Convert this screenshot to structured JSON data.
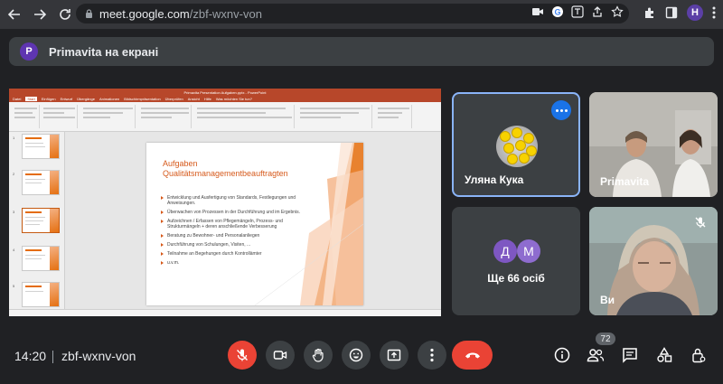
{
  "browser": {
    "url_host": "meet.google.com",
    "url_path": "/zbf-wxnv-von",
    "profile_initial": "H",
    "profile_color": "#5b3fa6"
  },
  "banner": {
    "presenter_initial": "P",
    "text": "Primavita на екрані"
  },
  "presentation": {
    "title_bar": "Primavita Presentation Aufgaben.pptx - PowerPoint",
    "tabs": [
      "Datei",
      "Start",
      "Einfügen",
      "Entwurf",
      "Übergänge",
      "Animationen",
      "Bildschirmpräsentation",
      "Überprüfen",
      "Ansicht",
      "Hilfe",
      "Was möchten Sie tun?"
    ],
    "active_tab": "Start",
    "thumb_numbers": [
      "1",
      "2",
      "3",
      "4",
      "5"
    ],
    "slide_title_line1": "Aufgaben",
    "slide_title_line2": "Qualitätsmanagementbeauftragten",
    "bullets": [
      "Entwicklung und Ausfertigung von Standards, Festlegungen und Anweisungen.",
      "Überwachen von Prozessen in der Durchführung und im Ergebnis.",
      "Aufzeichnen / Erfassen von Pflegemängeln, Prozess- und Strukturmängeln + deren anschließende Verbesserung",
      "Beratung zu Bewohner- und Personalanliegen",
      "Durchführung von Schulungen, Visiten, ...",
      "Teilnahme an Begehungen durch Kontrollämter",
      "u.v.m."
    ],
    "accent_color": "#d65a1c"
  },
  "participants": {
    "kuka": {
      "name": "Уляна Кука"
    },
    "primavita": {
      "name": "Primavita"
    },
    "group": {
      "initials": [
        "Д",
        "М"
      ],
      "colors": [
        "#7e57c2",
        "#8e6ccf"
      ],
      "text": "Ще 66 осіб"
    },
    "vy": {
      "name": "Ви"
    }
  },
  "meeting": {
    "time": "14:20",
    "code": "zbf-wxnv-von",
    "participant_count": "72",
    "leave_color": "#ea4335"
  },
  "icons": {
    "back": "arrow-left-icon",
    "forward": "arrow-right-icon",
    "reload": "reload-icon",
    "more": "more-dots-icon",
    "mic": "mic-off-icon",
    "camera": "camera-icon",
    "hand": "raise-hand-icon",
    "emoji": "emoji-icon",
    "present": "present-icon",
    "leave": "phone-hangup-icon",
    "info": "info-icon",
    "people": "people-icon",
    "chat": "chat-icon",
    "activities": "activities-icon",
    "host_controls": "lock-person-icon"
  }
}
